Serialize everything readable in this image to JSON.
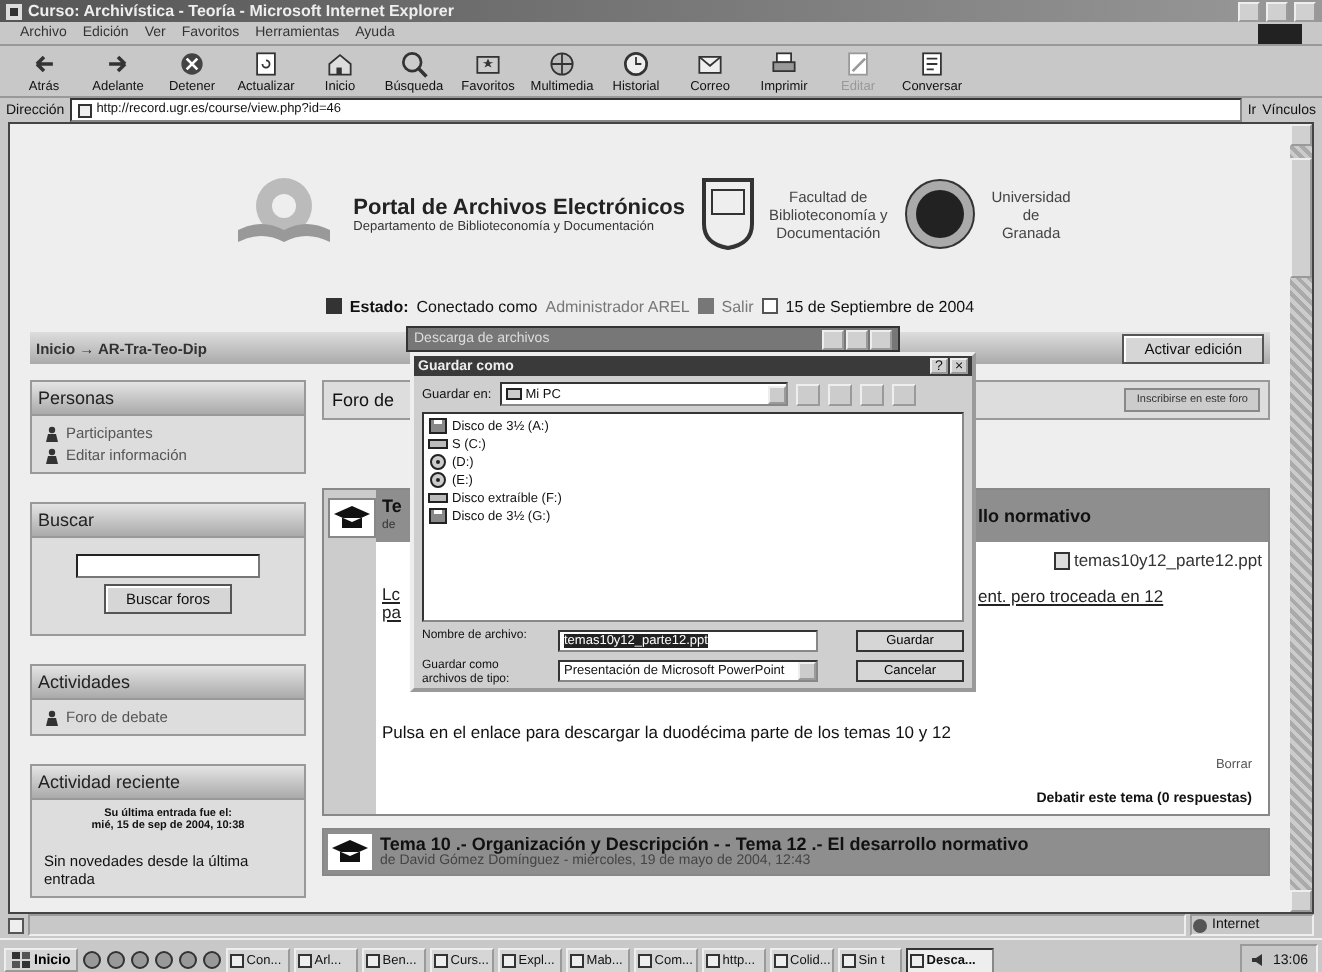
{
  "window": {
    "title": "Curso: Archivística - Teoría - Microsoft Internet Explorer"
  },
  "menu": [
    "Archivo",
    "Edición",
    "Ver",
    "Favoritos",
    "Herramientas",
    "Ayuda"
  ],
  "toolbar": [
    {
      "label": "Atrás",
      "disabled": false
    },
    {
      "label": "Adelante",
      "disabled": false
    },
    {
      "label": "Detener",
      "disabled": false
    },
    {
      "label": "Actualizar",
      "disabled": false
    },
    {
      "label": "Inicio",
      "disabled": false
    },
    {
      "label": "Búsqueda",
      "disabled": false
    },
    {
      "label": "Favoritos",
      "disabled": false
    },
    {
      "label": "Multimedia",
      "disabled": false
    },
    {
      "label": "Historial",
      "disabled": false
    },
    {
      "label": "Correo",
      "disabled": false
    },
    {
      "label": "Imprimir",
      "disabled": false
    },
    {
      "label": "Editar",
      "disabled": true
    },
    {
      "label": "Conversar",
      "disabled": false
    }
  ],
  "address": {
    "label": "Dirección",
    "value": "http://record.ugr.es/course/view.php?id=46",
    "go": "Ir",
    "links": "Vínculos"
  },
  "header": {
    "portal_title": "Portal de Archivos Electrónicos",
    "portal_subtitle": "Departamento de Biblioteconomía y Documentación",
    "faculty": "Facultad de\nBiblioteconomía y\nDocumentación",
    "university": "Universidad\nde\nGranada"
  },
  "status_line": {
    "label": "Estado:",
    "text": "Conectado como",
    "user": "Administrador AREL",
    "logout": "Salir",
    "date": "15 de Septiembre de 2004"
  },
  "breadcrumb": "Inicio → AR-Tra-Teo-Dip",
  "edit_button": "Activar edición",
  "blocks": [
    {
      "kind": "links",
      "title": "Personas",
      "items": [
        "Participantes",
        "Editar información"
      ]
    },
    {
      "kind": "search",
      "title": "Buscar",
      "button": "Buscar foros"
    },
    {
      "kind": "links",
      "title": "Actividades",
      "items": [
        "Foro de debate"
      ]
    },
    {
      "kind": "recent",
      "title": "Actividad reciente",
      "last_entry": "Su última entrada fue el:\nmié, 15 de sep de 2004, 10:38",
      "note": "Sin novedades desde la última entrada"
    }
  ],
  "forum": {
    "title": "Foro de",
    "subscribe": "Inscribirse en este foro"
  },
  "post": {
    "title_start": "Te",
    "title_end": "llo normativo",
    "byline_start": "de",
    "attachment": "temas10y12_parte12.ppt",
    "link_start_1": "Lc",
    "link_start_2": "pa",
    "link_end": "ent. pero troceada en 12",
    "message": "Pulsa en el enlace para descargar la duodécima parte de los temas 10 y 12",
    "delete": "Borrar",
    "discuss": "Debatir este tema (0 respuestas)"
  },
  "next_post": {
    "title": "Tema 10 .- Organización y Descripción - - Tema 12 .- El desarrollo normativo",
    "byline": "de David Gómez Domínguez - miércoles, 19 de mayo de 2004, 12:43"
  },
  "download_window": {
    "title": "Descarga de archivos"
  },
  "save_dialog": {
    "title": "Guardar como",
    "help": "?",
    "close": "×",
    "save_in_label": "Guardar en:",
    "save_in": "Mi PC",
    "items": [
      {
        "kind": "floppy",
        "label": "Disco de 3½ (A:)"
      },
      {
        "kind": "drive",
        "label": "S (C:)"
      },
      {
        "kind": "cd",
        "label": "(D:)"
      },
      {
        "kind": "cd",
        "label": "(E:)"
      },
      {
        "kind": "drive",
        "label": "Disco extraíble (F:)"
      },
      {
        "kind": "floppy",
        "label": "Disco de 3½ (G:)"
      }
    ],
    "filename_label": "Nombre de archivo:",
    "filename": "temas10y12_parte12.ppt",
    "type_label": "Guardar como\narchivos de tipo:",
    "type": "Presentación de Microsoft PowerPoint",
    "save": "Guardar",
    "cancel": "Cancelar"
  },
  "status_bar": {
    "zone": "Internet"
  },
  "taskbar": {
    "start": "Inicio",
    "tasks": [
      {
        "label": "Con...",
        "selected": false
      },
      {
        "label": "Arl...",
        "selected": false
      },
      {
        "label": "Ben...",
        "selected": false
      },
      {
        "label": "Curs...",
        "selected": false
      },
      {
        "label": "Expl...",
        "selected": false
      },
      {
        "label": "Mab...",
        "selected": false
      },
      {
        "label": "Com...",
        "selected": false
      },
      {
        "label": "http...",
        "selected": false
      },
      {
        "label": "Colid...",
        "selected": false
      },
      {
        "label": "Sin t",
        "selected": false
      },
      {
        "label": "Desca...",
        "selected": true
      }
    ],
    "clock": "13:06"
  }
}
